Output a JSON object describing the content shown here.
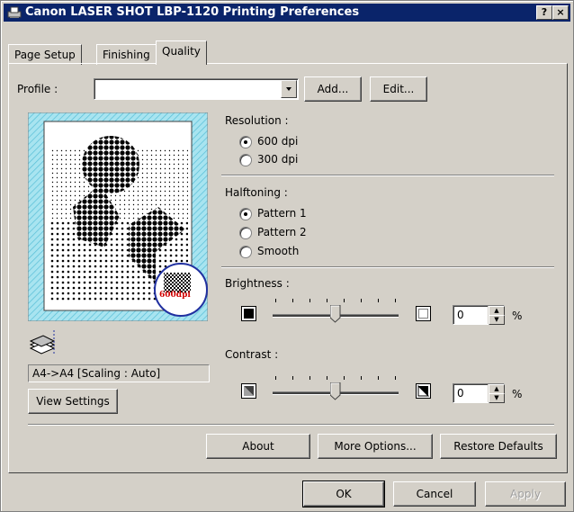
{
  "window": {
    "title": "Canon LASER SHOT LBP-1120 Printing Preferences",
    "help_label": "?",
    "close_label": "×"
  },
  "tabs": [
    {
      "label": "Page Setup"
    },
    {
      "label": "Finishing"
    },
    {
      "label": "Quality"
    }
  ],
  "active_tab": "Quality",
  "profile": {
    "label": "Profile :",
    "value": "",
    "add_label": "Add...",
    "edit_label": "Edit..."
  },
  "preview": {
    "badge": "600dpi",
    "paper_info": "A4->A4 [Scaling : Auto]",
    "view_settings_label": "View Settings"
  },
  "resolution": {
    "label": "Resolution :",
    "options": [
      "600 dpi",
      "300 dpi"
    ],
    "selected": "600 dpi"
  },
  "halftoning": {
    "label": "Halftoning :",
    "options": [
      "Pattern 1",
      "Pattern 2",
      "Smooth"
    ],
    "selected": "Pattern 1"
  },
  "brightness": {
    "label": "Brightness :",
    "value": "0",
    "unit": "%",
    "level": 0.5
  },
  "contrast": {
    "label": "Contrast :",
    "value": "0",
    "unit": "%",
    "level": 0.5
  },
  "panel_buttons": {
    "about": "About",
    "more_options": "More Options...",
    "restore_defaults": "Restore Defaults"
  },
  "dialog_buttons": {
    "ok": "OK",
    "cancel": "Cancel",
    "apply": "Apply"
  },
  "colors": {
    "titlebar": "#0a246a",
    "face": "#d4d0c8",
    "preview_bg": "#a8e4f0",
    "badge_red": "#d00000",
    "badge_ring": "#2030a0"
  }
}
